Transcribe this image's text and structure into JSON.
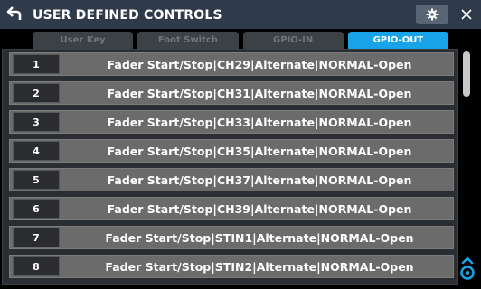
{
  "header": {
    "title": "USER DEFINED CONTROLS",
    "back_icon": "back-arrow-icon",
    "settings_icon": "gear-icon",
    "close_icon": "close-icon"
  },
  "tabs": [
    {
      "label": "User Key",
      "active": false
    },
    {
      "label": "Foot Switch",
      "active": false
    },
    {
      "label": "GPIO-IN",
      "active": false
    },
    {
      "label": "GPIO-OUT",
      "active": true
    }
  ],
  "rows": [
    {
      "number": "1",
      "text": "Fader Start/Stop|CH29|Alternate|NORMAL-Open"
    },
    {
      "number": "2",
      "text": "Fader Start/Stop|CH31|Alternate|NORMAL-Open"
    },
    {
      "number": "3",
      "text": "Fader Start/Stop|CH33|Alternate|NORMAL-Open"
    },
    {
      "number": "4",
      "text": "Fader Start/Stop|CH35|Alternate|NORMAL-Open"
    },
    {
      "number": "5",
      "text": "Fader Start/Stop|CH37|Alternate|NORMAL-Open"
    },
    {
      "number": "6",
      "text": "Fader Start/Stop|CH39|Alternate|NORMAL-Open"
    },
    {
      "number": "7",
      "text": "Fader Start/Stop|STIN1|Alternate|NORMAL-Open"
    },
    {
      "number": "8",
      "text": "Fader Start/Stop|STIN2|Alternate|NORMAL-Open"
    }
  ],
  "colors": {
    "accent": "#19a3e8",
    "titlebar": "#2f3b4a",
    "row_background": "#6b6b6b"
  }
}
